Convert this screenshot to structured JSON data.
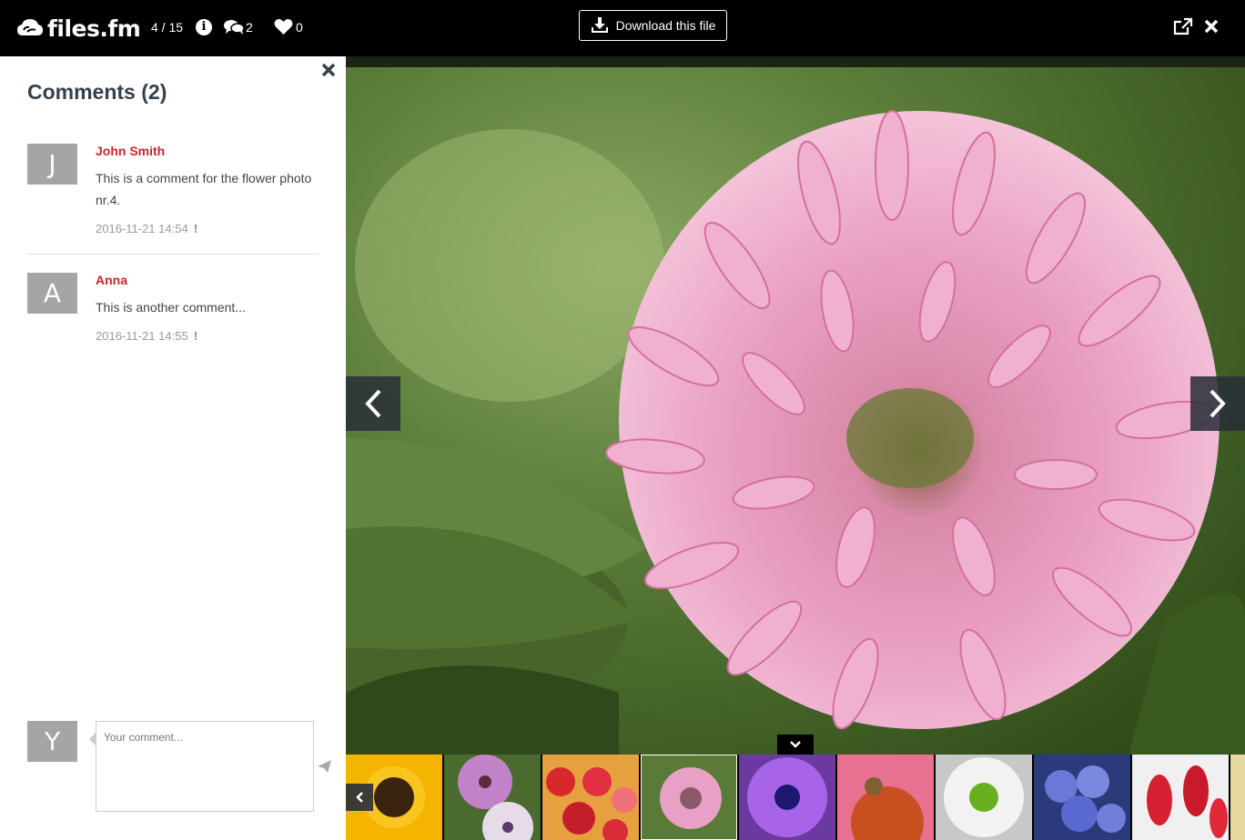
{
  "header": {
    "logo_text": "files.fm",
    "counter": "4 / 15",
    "comments_count": "2",
    "likes_count": "0",
    "download_label": "Download this file"
  },
  "comments_panel": {
    "title": "Comments (2)",
    "comments": [
      {
        "avatar_letter": "J",
        "author": "John Smith",
        "text": "This is a comment for the flower photo nr.4.",
        "date": "2016-11-21 14:54"
      },
      {
        "avatar_letter": "A",
        "author": "Anna",
        "text": "This is another comment...",
        "date": "2016-11-21 14:55"
      }
    ],
    "my_avatar_letter": "Y",
    "input_placeholder": "Your comment..."
  },
  "viewer": {
    "current_image": "pink clover flower",
    "thumbnails": [
      "sunflower",
      "purple daisies",
      "red daisies",
      "pink clover",
      "purple daisy",
      "coneflower",
      "white daisy",
      "blue plumbago",
      "red fuchsia"
    ],
    "active_thumbnail": "pink clover"
  },
  "colors": {
    "author": "#c8242a",
    "title": "#36404d",
    "avatar": "#a5a5a5"
  }
}
